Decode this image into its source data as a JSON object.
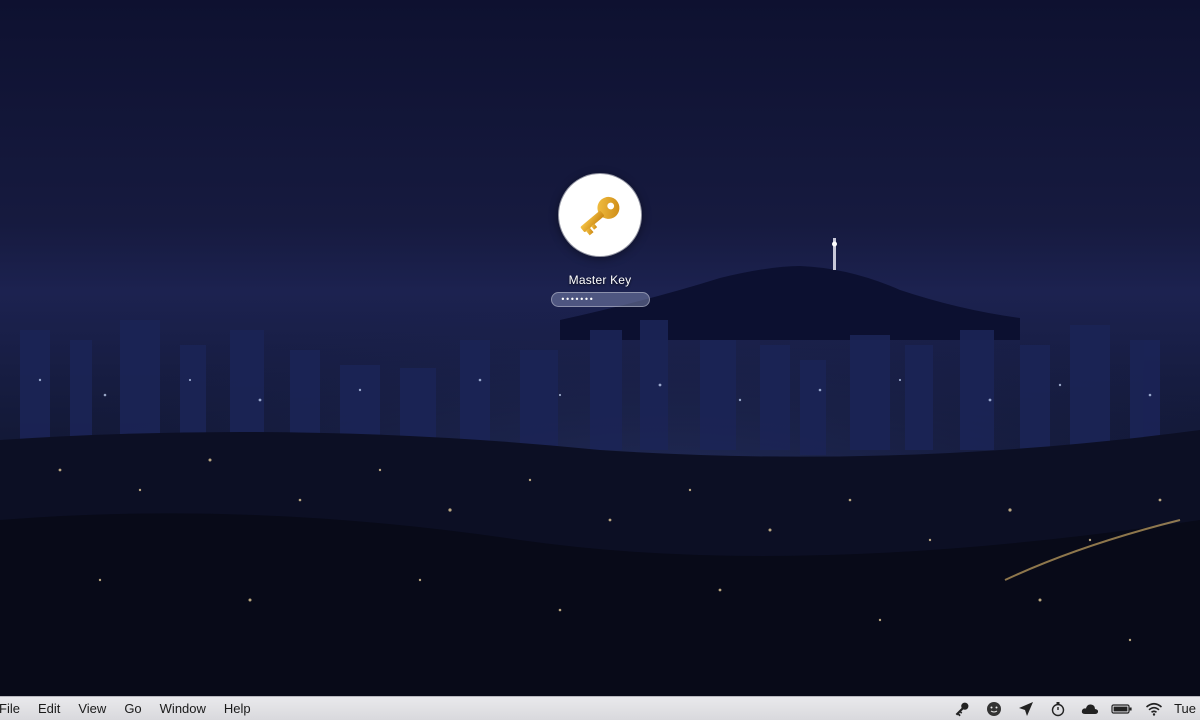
{
  "login": {
    "user_name": "Master Key",
    "password_mask": "•••••••",
    "avatar_icon": "key-icon",
    "avatar_color": "#ffffff",
    "key_color": "#e7a11c"
  },
  "menubar": {
    "items": [
      {
        "label": "File"
      },
      {
        "label": "Edit"
      },
      {
        "label": "View"
      },
      {
        "label": "Go"
      },
      {
        "label": "Window"
      },
      {
        "label": "Help"
      }
    ],
    "status_icons": [
      "key-icon",
      "face-icon",
      "location-arrow-icon",
      "timer-icon",
      "cloud-icon",
      "battery-icon",
      "wifi-icon"
    ],
    "clock": "Tue"
  }
}
